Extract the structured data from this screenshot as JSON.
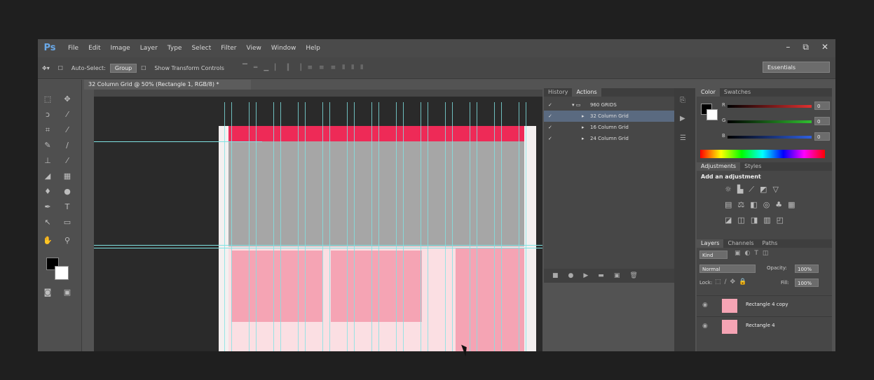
{
  "app": {
    "logo": "Ps"
  },
  "menu": [
    "File",
    "Edit",
    "Image",
    "Layer",
    "Type",
    "Select",
    "Filter",
    "View",
    "Window",
    "Help"
  ],
  "window_controls": {
    "minimize": "–",
    "restore": "⧉",
    "close": "✕"
  },
  "options": {
    "tool_icon": "move-tool",
    "auto_select": "Auto-Select:",
    "auto_select_value": "Group",
    "show_transform": "Show Transform Controls",
    "workspace": "Essentials"
  },
  "document_tab": "32 Column Grid @ 50% (Rectangle 1, RGB/8) *",
  "history_panel": {
    "tabs": [
      "History",
      "Actions"
    ],
    "active_tab": "Actions",
    "actions": [
      {
        "label": "960 GRIDS",
        "expanded": true
      },
      {
        "label": "32 Column Grid",
        "selected": true
      },
      {
        "label": "16 Column Grid"
      },
      {
        "label": "24 Column Grid"
      }
    ]
  },
  "color_panel": {
    "tabs": [
      "Color",
      "Swatches"
    ],
    "active_tab": "Color",
    "channels": [
      {
        "name": "R",
        "value": "0",
        "color": "#e03030"
      },
      {
        "name": "G",
        "value": "0",
        "color": "#30c030"
      },
      {
        "name": "B",
        "value": "0",
        "color": "#3060e0"
      }
    ]
  },
  "adjustments_panel": {
    "tabs": [
      "Adjustments",
      "Styles"
    ],
    "active_tab": "Adjustments",
    "heading": "Add an adjustment"
  },
  "layers_panel": {
    "tabs": [
      "Layers",
      "Channels",
      "Paths"
    ],
    "active_tab": "Layers",
    "filter": "Kind",
    "blend_mode": "Normal",
    "opacity_label": "Opacity:",
    "opacity": "100%",
    "lock_label": "Lock:",
    "fill_label": "Fill:",
    "fill": "100%",
    "layers": [
      {
        "name": "Rectangle 4 copy"
      },
      {
        "name": "Rectangle 4"
      }
    ]
  },
  "colors": {
    "accent_pink": "#ee2a57",
    "light_pink": "#f5a4b4",
    "guide": "#7fe3e3"
  }
}
